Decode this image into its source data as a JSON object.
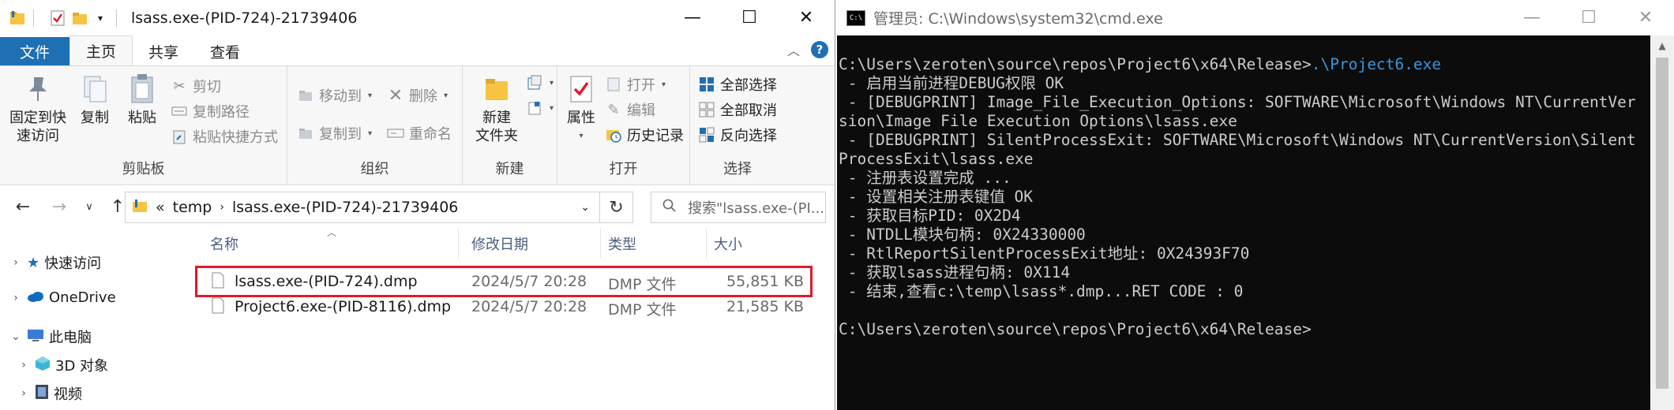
{
  "explorer": {
    "title": "lsass.exe-(PID-724)-21739406",
    "controls": {
      "minimize": "—",
      "maximize": "☐",
      "close": "✕"
    },
    "tabs": [
      "文件",
      "主页",
      "共享",
      "查看"
    ],
    "ribbon": {
      "clipboard": {
        "pin_quick_access": "固定到快\n速访问",
        "copy": "复制",
        "paste": "粘贴",
        "cut": "剪切",
        "copy_path": "复制路径",
        "paste_shortcut": "粘贴快捷方式",
        "label": "剪贴板"
      },
      "organize": {
        "move_to": "移动到",
        "copy_to": "复制到",
        "delete": "删除",
        "rename": "重命名",
        "label": "组织"
      },
      "new": {
        "new_folder": "新建\n文件夹",
        "label": "新建"
      },
      "open": {
        "properties": "属性",
        "open": "打开",
        "edit": "编辑",
        "history": "历史记录",
        "label": "打开"
      },
      "select": {
        "select_all": "全部选择",
        "select_none": "全部取消",
        "invert_selection": "反向选择",
        "label": "选择"
      }
    },
    "address": {
      "overflow": "«",
      "path": [
        "temp",
        "lsass.exe-(PID-724)-21739406"
      ],
      "search_placeholder": "搜索\"lsass.exe-(PI..."
    },
    "navpane": [
      {
        "label": "快速访问",
        "icon": "star-icon"
      },
      {
        "label": "OneDrive",
        "icon": "cloud-icon"
      },
      {
        "label": "此电脑",
        "icon": "computer-icon"
      },
      {
        "label": "3D 对象",
        "icon": "cube-icon"
      },
      {
        "label": "视频",
        "icon": "film-icon"
      }
    ],
    "columns": [
      "名称",
      "修改日期",
      "类型",
      "大小"
    ],
    "files": [
      {
        "name": "lsass.exe-(PID-724).dmp",
        "date": "2024/5/7 20:28",
        "type": "DMP 文件",
        "size": "55,851 KB"
      },
      {
        "name": "Project6.exe-(PID-8116).dmp",
        "date": "2024/5/7 20:28",
        "type": "DMP 文件",
        "size": "21,585 KB"
      }
    ],
    "colors": {
      "file_tab": "#1f6fb5",
      "highlight_box": "#e2192a",
      "folder": "#f5c542"
    }
  },
  "cmd": {
    "title": "管理员: C:\\Windows\\system32\\cmd.exe",
    "icon_text": "C:\\",
    "lines": [
      {
        "prompt": "C:\\Users\\zeroten\\source\\repos\\Project6\\x64\\Release>",
        "command": ".\\Project6.exe"
      },
      {
        "text": " - 启用当前进程DEBUG权限 OK"
      },
      {
        "text": " - [DEBUGPRINT] Image_File_Execution_Options: SOFTWARE\\Microsoft\\Windows NT\\CurrentVer"
      },
      {
        "text": "sion\\Image File Execution Options\\lsass.exe"
      },
      {
        "text": " - [DEBUGPRINT] SilentProcessExit: SOFTWARE\\Microsoft\\Windows NT\\CurrentVersion\\Silent"
      },
      {
        "text": "ProcessExit\\lsass.exe"
      },
      {
        "text": " - 注册表设置完成 ..."
      },
      {
        "text": " - 设置相关注册表键值 OK"
      },
      {
        "text": " - 获取目标PID: 0X2D4"
      },
      {
        "text": " - NTDLL模块句柄: 0X24330000"
      },
      {
        "text": " - RtlReportSilentProcessExit地址: 0X24393F70"
      },
      {
        "text": " - 获取lsass进程句柄: 0X114"
      },
      {
        "text": " - 结束,查看c:\\temp\\lsass*.dmp...RET CODE : 0"
      },
      {
        "text": ""
      },
      {
        "text": "C:\\Users\\zeroten\\source\\repos\\Project6\\x64\\Release>"
      }
    ],
    "colors": {
      "background": "#0c0c0c",
      "text": "#cccccc",
      "command": "#3a96dd"
    }
  }
}
